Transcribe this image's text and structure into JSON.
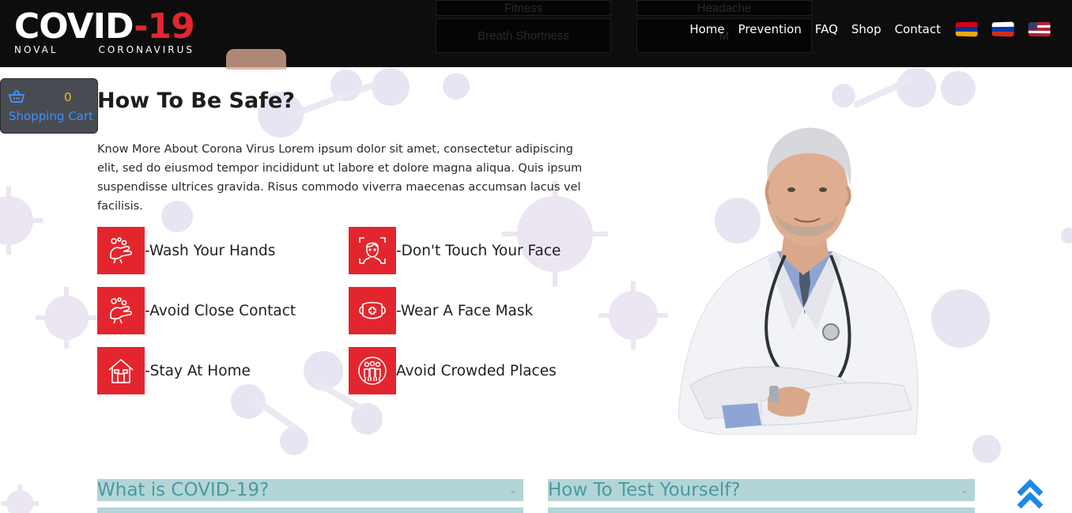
{
  "logo": {
    "word": "COVID",
    "number": "-19",
    "sub_left": "NOVAL",
    "sub_right": "CORONAVIRUS"
  },
  "symptom_boxes": {
    "top_left": "Fitness",
    "top_right": "Headache",
    "bottom_left": "Breath Shortness",
    "bottom_right": "M"
  },
  "nav": {
    "items": [
      "Home",
      "Prevention",
      "FAQ",
      "Shop",
      "Contact"
    ],
    "flags": [
      "armenia-flag-icon",
      "russia-flag-icon",
      "usa-flag-icon"
    ]
  },
  "cart": {
    "count": "0",
    "label": "Shopping Cart",
    "icon": "basket-icon"
  },
  "safety": {
    "title": "How To Be Safe?",
    "intro": "Know More About Corona Virus Lorem ipsum dolor sit amet, consectetur adipiscing elit, sed do eiusmod tempor incididunt ut labore et dolore magna aliqua. Quis ipsum suspendisse ultrices gravida. Risus commodo viverra maecenas accumsan lacus vel facilisis.",
    "tips": [
      {
        "label": "-Wash Your Hands",
        "icon": "hand-wash-icon"
      },
      {
        "label": "-Don't Touch Your Face",
        "icon": "face-icon"
      },
      {
        "label": "-Avoid Close Contact",
        "icon": "hand-wash-icon"
      },
      {
        "label": "-Wear A Face Mask",
        "icon": "face-mask-icon"
      },
      {
        "label": "-Stay At Home",
        "icon": "house-icon"
      },
      {
        "label": " Avoid Crowded Places",
        "icon": "crowd-icon"
      }
    ]
  },
  "faq": {
    "left_title": "What is COVID-19?",
    "right_title": "How To Test Yourself?"
  },
  "colors": {
    "brand_red": "#e3262e",
    "header_bg": "#0d0d0d",
    "accordion_bg": "#b4d5d6",
    "accordion_text": "#4a9aa0",
    "cart_count": "#f4c01c",
    "cart_label": "#3f8ffa",
    "scroll_top": "#1e88e5"
  }
}
